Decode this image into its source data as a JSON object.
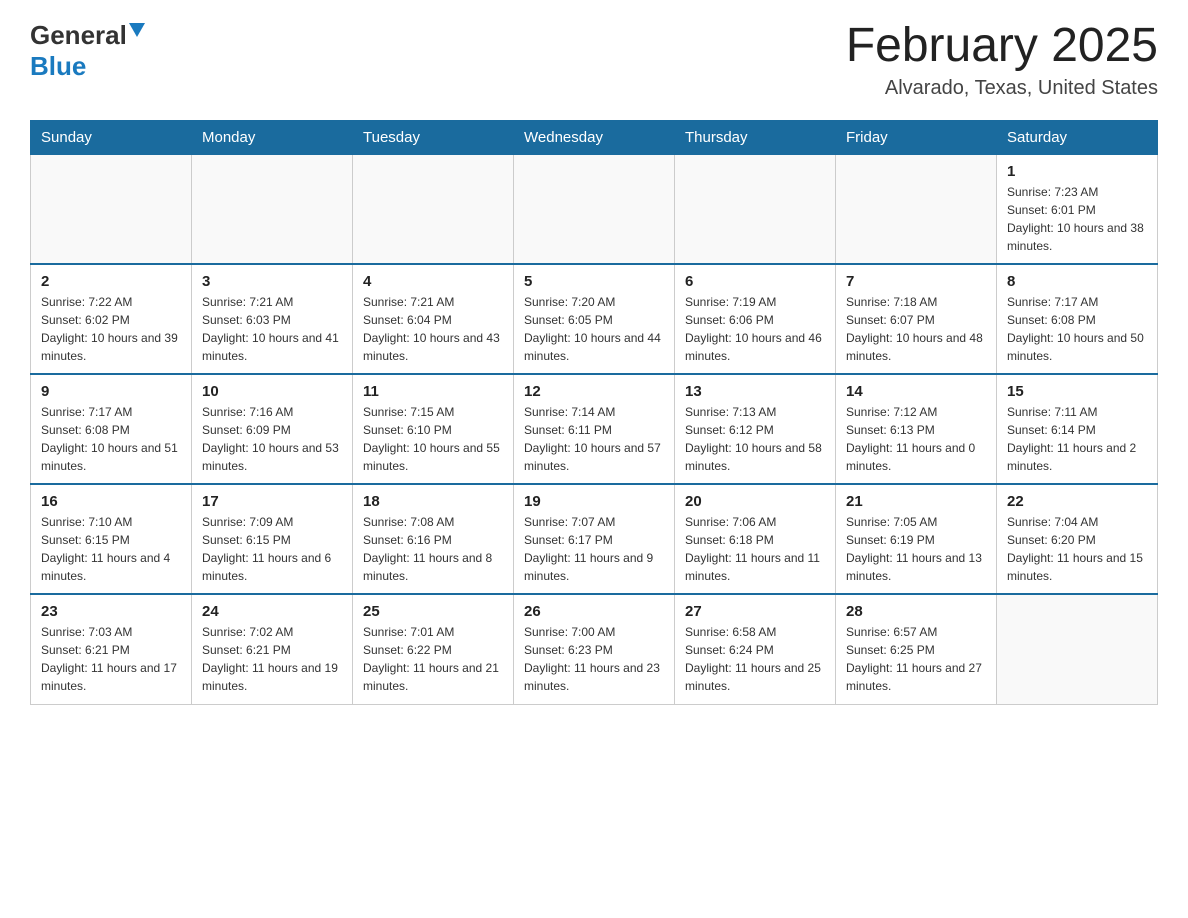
{
  "header": {
    "logo": {
      "general_text": "General",
      "blue_text": "Blue"
    },
    "month_title": "February 2025",
    "location": "Alvarado, Texas, United States"
  },
  "days_of_week": [
    "Sunday",
    "Monday",
    "Tuesday",
    "Wednesday",
    "Thursday",
    "Friday",
    "Saturday"
  ],
  "weeks": [
    {
      "days": [
        {
          "number": "",
          "sunrise": "",
          "sunset": "",
          "daylight": "",
          "empty": true
        },
        {
          "number": "",
          "sunrise": "",
          "sunset": "",
          "daylight": "",
          "empty": true
        },
        {
          "number": "",
          "sunrise": "",
          "sunset": "",
          "daylight": "",
          "empty": true
        },
        {
          "number": "",
          "sunrise": "",
          "sunset": "",
          "daylight": "",
          "empty": true
        },
        {
          "number": "",
          "sunrise": "",
          "sunset": "",
          "daylight": "",
          "empty": true
        },
        {
          "number": "",
          "sunrise": "",
          "sunset": "",
          "daylight": "",
          "empty": true
        },
        {
          "number": "1",
          "sunrise": "Sunrise: 7:23 AM",
          "sunset": "Sunset: 6:01 PM",
          "daylight": "Daylight: 10 hours and 38 minutes.",
          "empty": false
        }
      ]
    },
    {
      "days": [
        {
          "number": "2",
          "sunrise": "Sunrise: 7:22 AM",
          "sunset": "Sunset: 6:02 PM",
          "daylight": "Daylight: 10 hours and 39 minutes.",
          "empty": false
        },
        {
          "number": "3",
          "sunrise": "Sunrise: 7:21 AM",
          "sunset": "Sunset: 6:03 PM",
          "daylight": "Daylight: 10 hours and 41 minutes.",
          "empty": false
        },
        {
          "number": "4",
          "sunrise": "Sunrise: 7:21 AM",
          "sunset": "Sunset: 6:04 PM",
          "daylight": "Daylight: 10 hours and 43 minutes.",
          "empty": false
        },
        {
          "number": "5",
          "sunrise": "Sunrise: 7:20 AM",
          "sunset": "Sunset: 6:05 PM",
          "daylight": "Daylight: 10 hours and 44 minutes.",
          "empty": false
        },
        {
          "number": "6",
          "sunrise": "Sunrise: 7:19 AM",
          "sunset": "Sunset: 6:06 PM",
          "daylight": "Daylight: 10 hours and 46 minutes.",
          "empty": false
        },
        {
          "number": "7",
          "sunrise": "Sunrise: 7:18 AM",
          "sunset": "Sunset: 6:07 PM",
          "daylight": "Daylight: 10 hours and 48 minutes.",
          "empty": false
        },
        {
          "number": "8",
          "sunrise": "Sunrise: 7:17 AM",
          "sunset": "Sunset: 6:08 PM",
          "daylight": "Daylight: 10 hours and 50 minutes.",
          "empty": false
        }
      ]
    },
    {
      "days": [
        {
          "number": "9",
          "sunrise": "Sunrise: 7:17 AM",
          "sunset": "Sunset: 6:08 PM",
          "daylight": "Daylight: 10 hours and 51 minutes.",
          "empty": false
        },
        {
          "number": "10",
          "sunrise": "Sunrise: 7:16 AM",
          "sunset": "Sunset: 6:09 PM",
          "daylight": "Daylight: 10 hours and 53 minutes.",
          "empty": false
        },
        {
          "number": "11",
          "sunrise": "Sunrise: 7:15 AM",
          "sunset": "Sunset: 6:10 PM",
          "daylight": "Daylight: 10 hours and 55 minutes.",
          "empty": false
        },
        {
          "number": "12",
          "sunrise": "Sunrise: 7:14 AM",
          "sunset": "Sunset: 6:11 PM",
          "daylight": "Daylight: 10 hours and 57 minutes.",
          "empty": false
        },
        {
          "number": "13",
          "sunrise": "Sunrise: 7:13 AM",
          "sunset": "Sunset: 6:12 PM",
          "daylight": "Daylight: 10 hours and 58 minutes.",
          "empty": false
        },
        {
          "number": "14",
          "sunrise": "Sunrise: 7:12 AM",
          "sunset": "Sunset: 6:13 PM",
          "daylight": "Daylight: 11 hours and 0 minutes.",
          "empty": false
        },
        {
          "number": "15",
          "sunrise": "Sunrise: 7:11 AM",
          "sunset": "Sunset: 6:14 PM",
          "daylight": "Daylight: 11 hours and 2 minutes.",
          "empty": false
        }
      ]
    },
    {
      "days": [
        {
          "number": "16",
          "sunrise": "Sunrise: 7:10 AM",
          "sunset": "Sunset: 6:15 PM",
          "daylight": "Daylight: 11 hours and 4 minutes.",
          "empty": false
        },
        {
          "number": "17",
          "sunrise": "Sunrise: 7:09 AM",
          "sunset": "Sunset: 6:15 PM",
          "daylight": "Daylight: 11 hours and 6 minutes.",
          "empty": false
        },
        {
          "number": "18",
          "sunrise": "Sunrise: 7:08 AM",
          "sunset": "Sunset: 6:16 PM",
          "daylight": "Daylight: 11 hours and 8 minutes.",
          "empty": false
        },
        {
          "number": "19",
          "sunrise": "Sunrise: 7:07 AM",
          "sunset": "Sunset: 6:17 PM",
          "daylight": "Daylight: 11 hours and 9 minutes.",
          "empty": false
        },
        {
          "number": "20",
          "sunrise": "Sunrise: 7:06 AM",
          "sunset": "Sunset: 6:18 PM",
          "daylight": "Daylight: 11 hours and 11 minutes.",
          "empty": false
        },
        {
          "number": "21",
          "sunrise": "Sunrise: 7:05 AM",
          "sunset": "Sunset: 6:19 PM",
          "daylight": "Daylight: 11 hours and 13 minutes.",
          "empty": false
        },
        {
          "number": "22",
          "sunrise": "Sunrise: 7:04 AM",
          "sunset": "Sunset: 6:20 PM",
          "daylight": "Daylight: 11 hours and 15 minutes.",
          "empty": false
        }
      ]
    },
    {
      "days": [
        {
          "number": "23",
          "sunrise": "Sunrise: 7:03 AM",
          "sunset": "Sunset: 6:21 PM",
          "daylight": "Daylight: 11 hours and 17 minutes.",
          "empty": false
        },
        {
          "number": "24",
          "sunrise": "Sunrise: 7:02 AM",
          "sunset": "Sunset: 6:21 PM",
          "daylight": "Daylight: 11 hours and 19 minutes.",
          "empty": false
        },
        {
          "number": "25",
          "sunrise": "Sunrise: 7:01 AM",
          "sunset": "Sunset: 6:22 PM",
          "daylight": "Daylight: 11 hours and 21 minutes.",
          "empty": false
        },
        {
          "number": "26",
          "sunrise": "Sunrise: 7:00 AM",
          "sunset": "Sunset: 6:23 PM",
          "daylight": "Daylight: 11 hours and 23 minutes.",
          "empty": false
        },
        {
          "number": "27",
          "sunrise": "Sunrise: 6:58 AM",
          "sunset": "Sunset: 6:24 PM",
          "daylight": "Daylight: 11 hours and 25 minutes.",
          "empty": false
        },
        {
          "number": "28",
          "sunrise": "Sunrise: 6:57 AM",
          "sunset": "Sunset: 6:25 PM",
          "daylight": "Daylight: 11 hours and 27 minutes.",
          "empty": false
        },
        {
          "number": "",
          "sunrise": "",
          "sunset": "",
          "daylight": "",
          "empty": true
        }
      ]
    }
  ]
}
